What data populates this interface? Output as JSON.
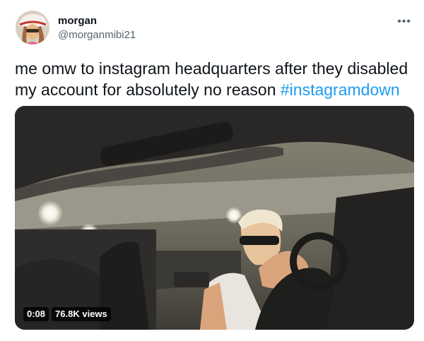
{
  "author": {
    "display_name": "morgan",
    "handle": "@morganmibi21"
  },
  "tweet": {
    "text": "me omw to instagram headquarters after they disabled my account for absolutely no reason ",
    "hashtag": "#instagramdown"
  },
  "media": {
    "duration": "0:08",
    "views": "76.8K views"
  },
  "icons": {
    "more": "more-options-icon"
  }
}
